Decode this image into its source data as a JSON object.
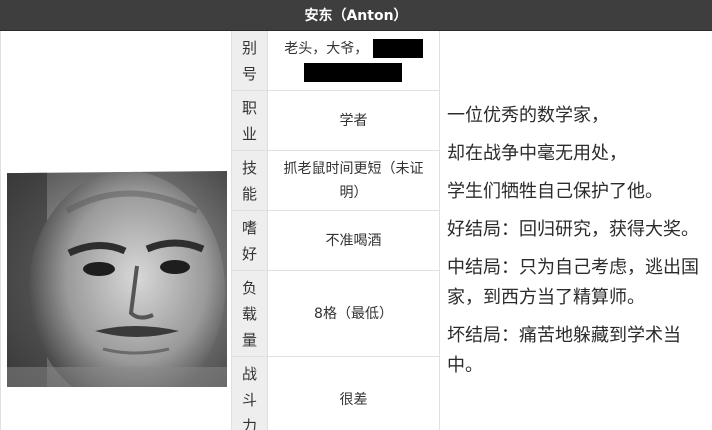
{
  "title": "安东（Anton）",
  "photo": {
    "subject": "portrait-of-anton"
  },
  "attributes": [
    {
      "label": "别号",
      "value": "老头，大爷，"
    },
    {
      "label": "职业",
      "value": "学者"
    },
    {
      "label": "技能",
      "value": "抓老鼠时间更短（未证明）"
    },
    {
      "label": "嗜好",
      "value": "不准喝酒"
    },
    {
      "label": "负载量",
      "value": "8格（最低）"
    },
    {
      "label": "战斗力",
      "value": "很差"
    }
  ],
  "description": [
    "一位优秀的数学家，",
    "却在战争中毫无用处，",
    "学生们牺牲自己保护了他。",
    "好结局：回归研究，获得大奖。",
    "中结局：只为自己考虑，逃出国家，到西方当了精算师。",
    "坏结局：痛苦地躲藏到学术当中。"
  ]
}
